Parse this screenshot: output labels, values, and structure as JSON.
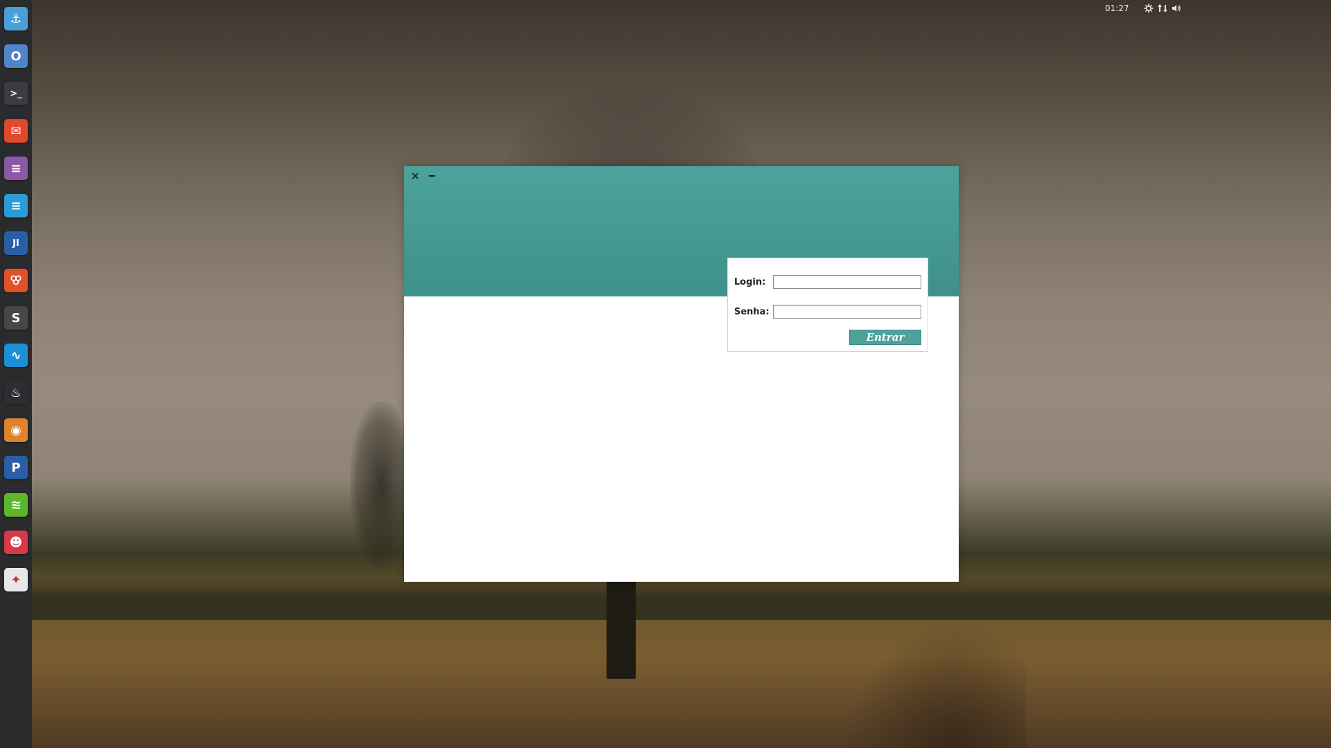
{
  "dock": {
    "items": [
      {
        "name": "anchor",
        "glyph": "⚓",
        "color": "#4a9fd8"
      },
      {
        "name": "chromium",
        "glyph": "O",
        "color": "#4e86c9"
      },
      {
        "name": "terminal",
        "glyph": ">_",
        "color": "#3a3c3f"
      },
      {
        "name": "mail",
        "glyph": "✉",
        "color": "#e0492c"
      },
      {
        "name": "text-editor",
        "glyph": "≡",
        "color": "#8a5aa8"
      },
      {
        "name": "documents",
        "glyph": "≡",
        "color": "#2d9bd8"
      },
      {
        "name": "intellij",
        "glyph": "JI",
        "color": "#2a5ea6"
      },
      {
        "name": "xampp",
        "glyph": "ꕢ",
        "color": "#e0512a"
      },
      {
        "name": "sublime",
        "glyph": "S",
        "color": "#474747"
      },
      {
        "name": "monitor",
        "glyph": "∿",
        "color": "#1d8fd6"
      },
      {
        "name": "steam",
        "glyph": "♨",
        "color": "#2c2e31"
      },
      {
        "name": "gimp",
        "glyph": "◉",
        "color": "#e0822e"
      },
      {
        "name": "pycharm",
        "glyph": "P",
        "color": "#2a5ea6"
      },
      {
        "name": "spotify",
        "glyph": "≋",
        "color": "#5cb82a"
      },
      {
        "name": "popcorn",
        "glyph": "☻",
        "color": "#d63a48"
      },
      {
        "name": "java-app",
        "glyph": "✦",
        "color": "#e8e8e8"
      }
    ]
  },
  "tray": {
    "clock": "01:27"
  },
  "window": {
    "header_color": "#4da39b",
    "login": {
      "login_label": "Login:",
      "login_value": "",
      "senha_label": "Senha:",
      "senha_value": "",
      "submit_label": "Entrar"
    }
  }
}
